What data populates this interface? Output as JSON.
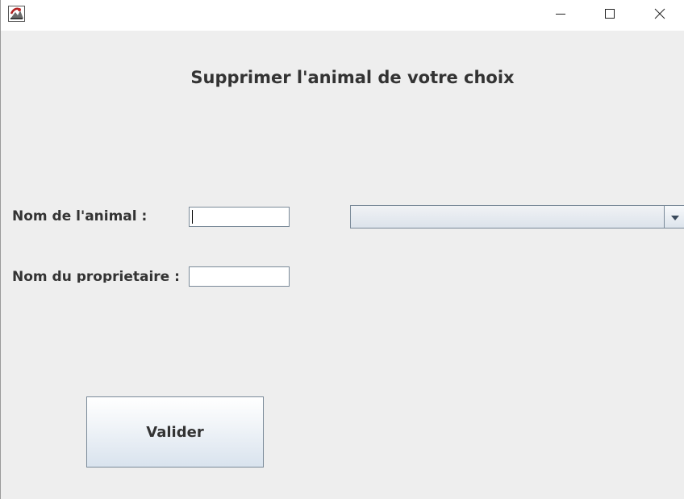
{
  "window": {
    "title": "",
    "icon": "java-app-icon",
    "controls": [
      "minimize-icon",
      "maximize-icon",
      "close-icon"
    ]
  },
  "form": {
    "heading": "Supprimer l'animal de votre choix",
    "animal_name_label": "Nom de l'animal :",
    "animal_name_value": "",
    "owner_name_label": "Nom du proprietaire :",
    "owner_name_value": "",
    "animal_select_value": "",
    "submit_label": "Valider"
  },
  "colors": {
    "background": "#eeeeee",
    "text": "#333333",
    "border": "#7a8a99"
  }
}
